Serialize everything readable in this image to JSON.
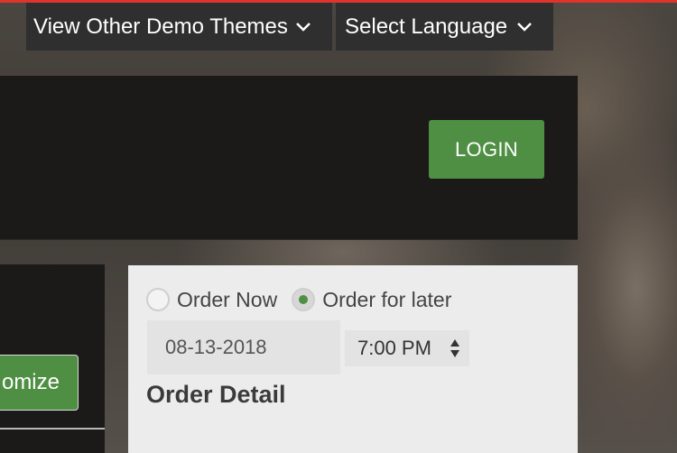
{
  "topbar": {
    "themes_label": "View Other Demo Themes",
    "language_label": "Select Language",
    "accent_color": "#e0332b"
  },
  "header": {
    "login_label": "LOGIN"
  },
  "left": {
    "customize_label": "omize"
  },
  "order": {
    "options": [
      "Order Now",
      "Order for later"
    ],
    "selected": "Order for later",
    "date_value": "08-13-2018",
    "time_value": "7:00 PM",
    "detail_title": "Order Detail"
  },
  "colors": {
    "primary_green": "#4e8f43"
  },
  "icons": [
    "chevron-down-icon",
    "updown-arrows-icon"
  ]
}
